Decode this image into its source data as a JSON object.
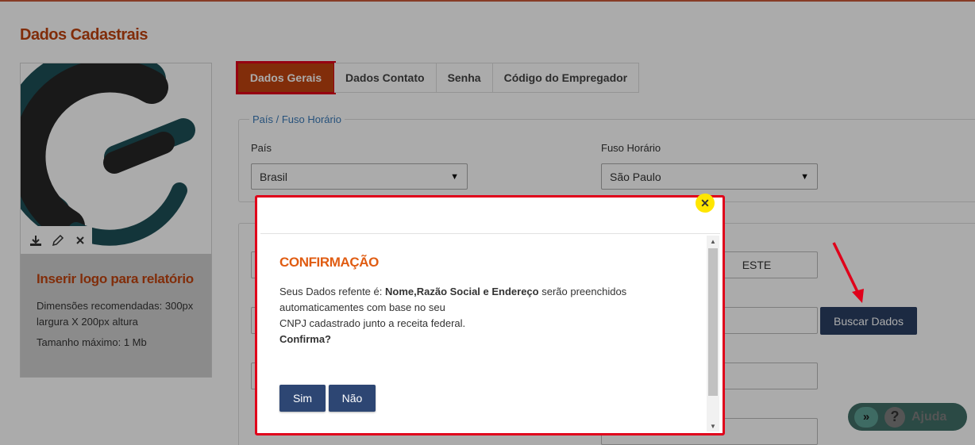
{
  "page": {
    "title": "Dados Cadastrais"
  },
  "logo_card": {
    "title": "Inserir logo para relatório",
    "recommended": "Dimensões recomendadas: 300px largura X 200px altura",
    "max_size": "Tamanho máximo: 1 Mb",
    "tools": [
      "download-icon",
      "pencil-icon",
      "close-icon"
    ]
  },
  "tabs": [
    {
      "label": "Dados Gerais",
      "active": true
    },
    {
      "label": "Dados Contato",
      "active": false
    },
    {
      "label": "Senha",
      "active": false
    },
    {
      "label": "Código do Empregador",
      "active": false
    }
  ],
  "country_section": {
    "legend": "País / Fuso Horário",
    "country_label": "País",
    "country_value": "Brasil",
    "timezone_label": "Fuso Horário",
    "timezone_value": "São Paulo"
  },
  "company": {
    "partial_value": "ESTE",
    "search_button": "Buscar Dados"
  },
  "help": {
    "label": "Ajuda"
  },
  "modal": {
    "title": "CONFIRMAÇÃO",
    "line1_prefix": "Seus Dados refente é: ",
    "line1_bold": "Nome,Razão Social e Endereço",
    "line1_suffix": " serão preenchidos",
    "line2": "automaticamentes com base no seu",
    "line3": "CNPJ cadastrado junto a receita federal.",
    "question": "Confirma?",
    "yes_button": "Sim",
    "no_button": "Não"
  },
  "colors": {
    "accent": "#c0440f",
    "primary_button": "#2d4673",
    "highlight": "#e0001a"
  }
}
